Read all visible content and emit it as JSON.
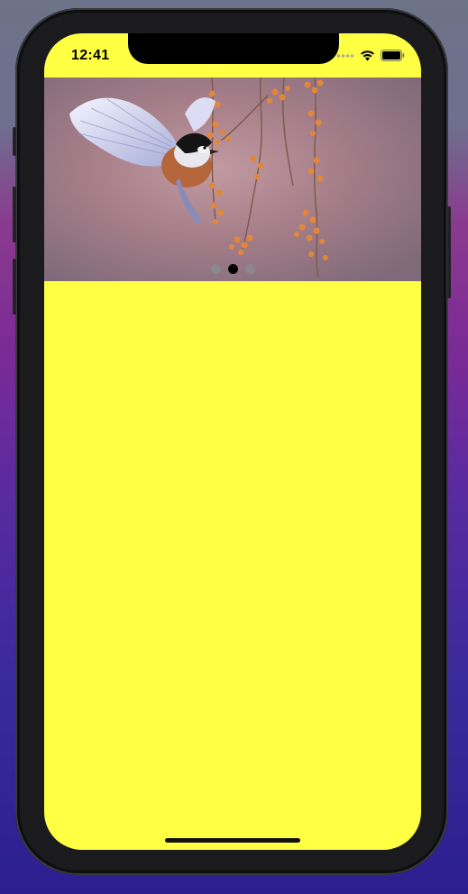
{
  "status_bar": {
    "time": "12:41",
    "wifi_icon": "wifi-icon",
    "battery_icon": "battery-icon",
    "signal_icon": "signal-dots-icon"
  },
  "banner": {
    "image": "bird-with-berries-photo",
    "page_count": 3,
    "current_page": 2
  },
  "colors": {
    "screen_background": "#ffff44",
    "active_dot": "#000000",
    "inactive_dot": "#8a8a92"
  }
}
